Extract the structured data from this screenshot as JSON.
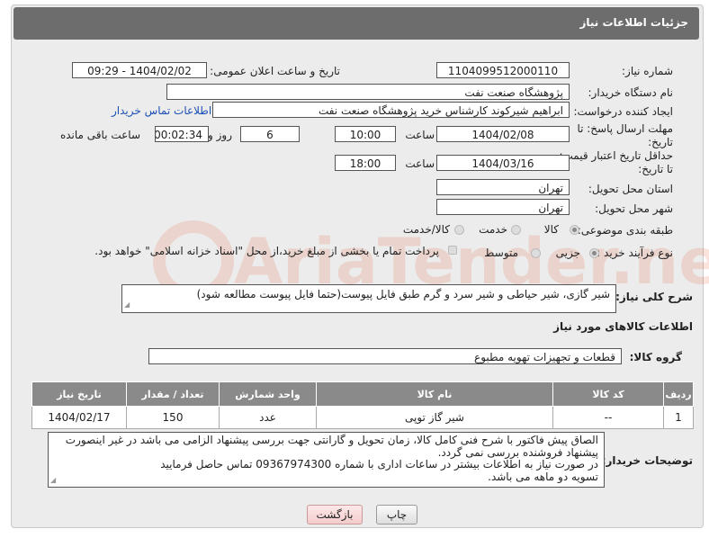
{
  "header": {
    "title": "جزئیات اطلاعات نیاز"
  },
  "form": {
    "need_number_label": "شماره نیاز:",
    "need_number": "1104099512000110",
    "announce_label": "تاریخ و ساعت اعلان عمومی:",
    "announce_value": "1404/02/02 - 09:29",
    "buyer_org_label": "نام دستگاه خریدار:",
    "buyer_org": "پژوهشگاه صنعت نفت",
    "creator_label": "ایجاد کننده درخواست:",
    "creator": "ابراهیم شیرکوند کارشناس خرید پژوهشگاه صنعت نفت",
    "contact_link": "اطلاعات تماس خریدار",
    "reply_deadline_label": "مهلت ارسال پاسخ: تا تاریخ:",
    "reply_date": "1404/02/08",
    "time_label": "ساعت",
    "reply_time": "10:00",
    "days_value": "6",
    "days_label": "روز و",
    "remaining_value": "00:02:34",
    "remaining_label": "ساعت باقی مانده",
    "price_validity_label": "حداقل تاریخ اعتبار قیمت: تا تاریخ:",
    "price_date": "1404/03/16",
    "price_time": "18:00",
    "province_label": "استان محل تحویل:",
    "province": "تهران",
    "city_label": "شهر محل تحویل:",
    "city": "تهران",
    "category_label": "طبقه بندی موضوعی:",
    "category_options": [
      "کالا",
      "خدمت",
      "کالا/خدمت"
    ],
    "process_label": "نوع فرآیند خرید :",
    "process_options": [
      "جزیی",
      "متوسط"
    ],
    "payment_note": "پرداخت تمام یا بخشی از مبلغ خرید،از محل \"اسناد خزانه اسلامی\" خواهد بود.",
    "summary_label": "شرح کلی نیاز:",
    "summary": "شیر گازی، شیر حیاطی و شیر سرد و گرم طبق فایل پیوست(حتما فایل پیوست مطالعه شود)",
    "goods_info_title": "اطلاعات کالاهای مورد نیاز",
    "goods_group_label": "گروه کالا:",
    "goods_group": "قطعات و تجهیزات تهویه مطبوع"
  },
  "table": {
    "headers": [
      "ردیف",
      "کد کالا",
      "نام کالا",
      "واحد شمارش",
      "تعداد / مقدار",
      "تاریخ نیاز"
    ],
    "rows": [
      [
        "1",
        "--",
        "شیر گاز توپی",
        "عدد",
        "150",
        "1404/02/17"
      ]
    ]
  },
  "notes": {
    "label": "توضیحات خریدار:",
    "lines": [
      "الصاق پیش فاکتور با شرح فنی کامل کالا، زمان تحویل و گارانتی جهت بررسی پیشنهاد الزامی می باشد در غیر اینصورت",
      "پیشنهاد فروشنده بررسی نمی گردد.",
      "در صورت نیاز به اطلاعات بیشتر در ساعات اداری با شماره 09367974300 تماس حاصل فرمایید",
      "تسویه دو ماهه می باشد."
    ]
  },
  "buttons": {
    "print": "چاپ",
    "back": "بازگشت"
  },
  "colors": {
    "header_bg": "#6d6d6d",
    "link": "#1a4fb5",
    "table_header": "#8a8a8a"
  }
}
